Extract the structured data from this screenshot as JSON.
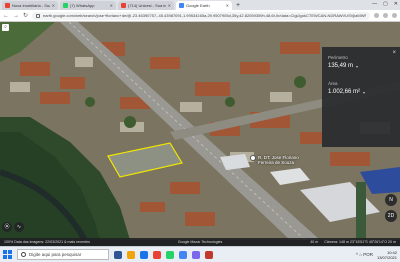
{
  "browser": {
    "tabs": [
      {
        "label": "Nova Imobiliária - Sua imobiliária e",
        "favicon_color": "#e94235",
        "active": false
      },
      {
        "label": "(7) WhatsApp",
        "favicon_color": "#25d366",
        "active": false
      },
      {
        "label": "(714) Unicesi - Sua imobiliária e",
        "favicon_color": "#e94235",
        "active": false
      },
      {
        "label": "Google Earth",
        "favicon_color": "#4285f4",
        "active": true
      }
    ],
    "newtab_label": "+",
    "window_controls": [
      "—",
      "▢",
      "✕"
    ],
    "url": "earth.google.com/web/search/jose+floriano+de/@-23.46390757,-45.43987091,1.99534165a,29.9507905d,35y,42.82059359h,48.6t,0r/data=CigiJgokCTEWCAN-NDRAWVUSVjlaMWRT"
  },
  "map": {
    "search_icon": "search-icon",
    "place_label_line1": "R. DT. Jose Floriano",
    "place_label_line2": "Ferreira de Souza",
    "polygon_color": "#f2e600",
    "measure": {
      "perimeter_label": "Perímetro",
      "perimeter_value": "135,49 m",
      "area_label": "Área",
      "area_value": "1.002,66 m²",
      "close_label": "×",
      "unit_arrow": "▾"
    },
    "right_controls": [
      "N",
      "2D"
    ],
    "left_controls": [
      "⦿",
      "∿"
    ],
    "footer": {
      "left": "100%   Data das imagens: 22/03/2021   & mais recentes",
      "center": "Google   Maxar Technologies",
      "right1": "40 m",
      "right2": "Câmera: 148 m   23°16'51\"S 45°26'14\"O   20 m"
    }
  },
  "taskbar": {
    "search_placeholder": "Digite aqui para pesquisar",
    "app_icons": [
      "#2f5597",
      "#f0a30a",
      "#1a73e8",
      "#e94235",
      "#25d366",
      "#4285f4",
      "#7b68ee",
      "#c0392b"
    ],
    "tray_text": "^  ⌂  POR",
    "time": "10:42",
    "date": "13/07/2021"
  }
}
